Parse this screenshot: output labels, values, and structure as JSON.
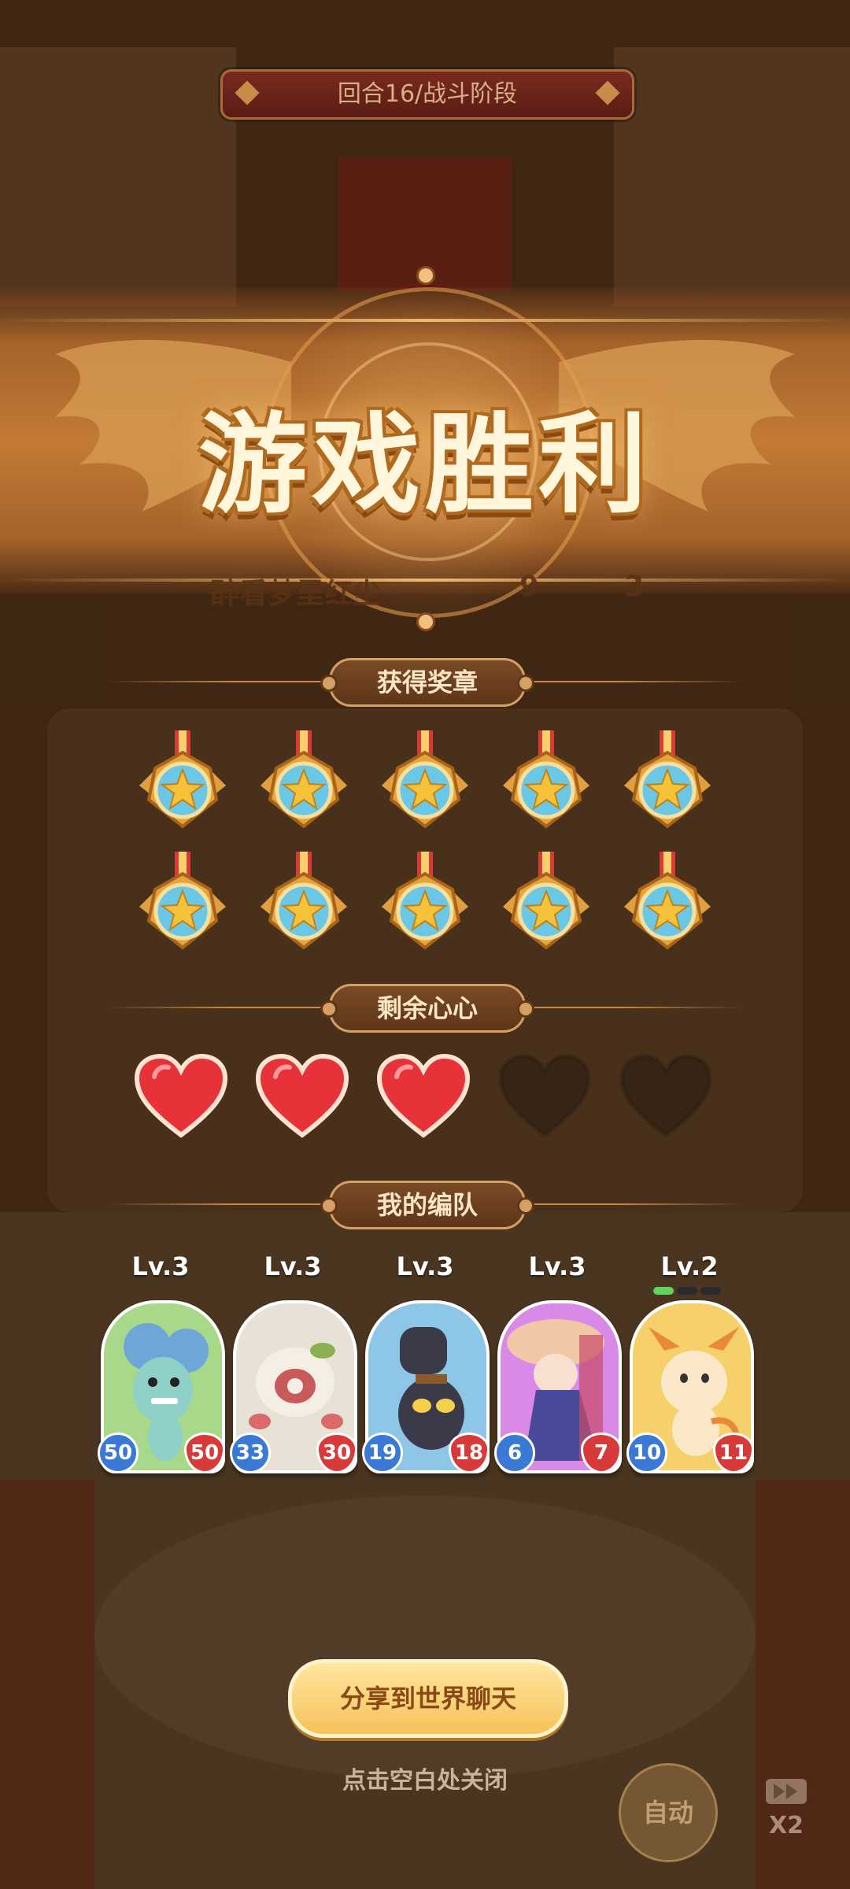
{
  "round_banner": "回合16/战斗阶段",
  "result_title": "游戏胜利",
  "background_player": {
    "name": "醉看梦里红尘",
    "stat_a": "9",
    "stat_b": "3"
  },
  "sections": {
    "medals": "获得奖章",
    "hearts": "剩余心心",
    "team": "我的编队"
  },
  "medals": {
    "earned": 10,
    "icon": "star-medal-icon"
  },
  "hearts": {
    "remaining": 3,
    "total": 5,
    "icon": "heart-icon"
  },
  "team": [
    {
      "level": "Lv.3",
      "attack": "50",
      "hp": "50",
      "bg": "#a8d88a"
    },
    {
      "level": "Lv.3",
      "attack": "33",
      "hp": "30",
      "bg": "#e8e2d6"
    },
    {
      "level": "Lv.3",
      "attack": "19",
      "hp": "18",
      "bg": "#8ec6e8"
    },
    {
      "level": "Lv.3",
      "attack": "6",
      "hp": "7",
      "bg": "#d98ae6"
    },
    {
      "level": "Lv.2",
      "attack": "10",
      "hp": "11",
      "bg": "#f6d06a",
      "progress_pips": 1,
      "pip_total": 3
    }
  ],
  "buttons": {
    "share": "分享到世界聊天",
    "close_hint": "点击空白处关闭",
    "auto": "自动",
    "speed": "X2"
  },
  "colors": {
    "accent_gold": "#f6c25a",
    "attack_blue": "#3a7ad6",
    "hp_red": "#d83a3a"
  }
}
